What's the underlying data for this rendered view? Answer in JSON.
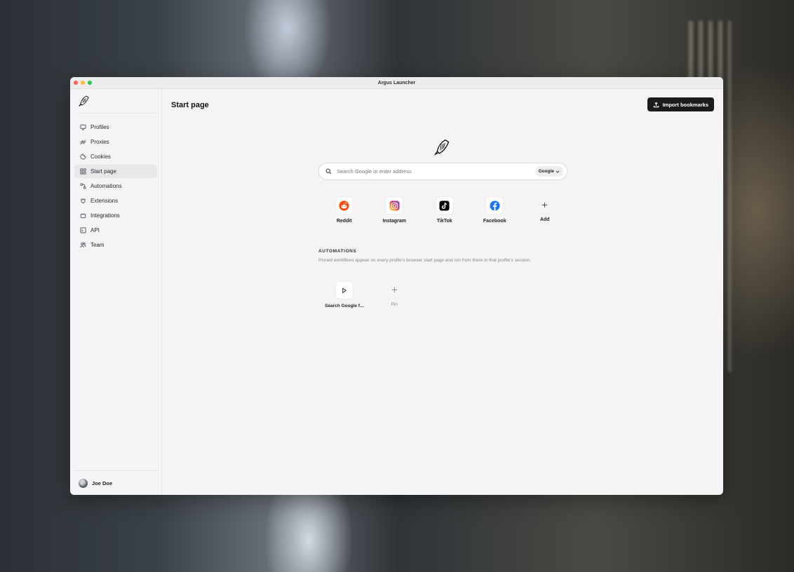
{
  "window": {
    "title": "Argus Launcher"
  },
  "sidebar": {
    "items": [
      {
        "label": "Profiles",
        "icon": "monitor-icon"
      },
      {
        "label": "Proxies",
        "icon": "proxy-icon"
      },
      {
        "label": "Cookies",
        "icon": "cookie-icon"
      },
      {
        "label": "Start page",
        "icon": "grid-icon",
        "active": true
      },
      {
        "label": "Automations",
        "icon": "automation-icon"
      },
      {
        "label": "Extensions",
        "icon": "plug-icon"
      },
      {
        "label": "Integrations",
        "icon": "integration-icon"
      },
      {
        "label": "API",
        "icon": "terminal-icon"
      },
      {
        "label": "Team",
        "icon": "team-icon"
      }
    ],
    "user": {
      "name": "Joe Doe"
    }
  },
  "header": {
    "title": "Start page",
    "import_label": "Import bookmarks"
  },
  "search": {
    "placeholder": "Search Google or enter address",
    "engine": "Google"
  },
  "shortcuts": [
    {
      "label": "Reddit",
      "icon": "reddit-icon",
      "color": "#ff4500"
    },
    {
      "label": "Instagram",
      "icon": "instagram-icon",
      "color": "#d62976"
    },
    {
      "label": "TikTok",
      "icon": "tiktok-icon",
      "color": "#000000"
    },
    {
      "label": "Facebook",
      "icon": "facebook-icon",
      "color": "#1877f2"
    },
    {
      "label": "Add",
      "icon": "plus-icon"
    }
  ],
  "automations": {
    "heading": "AUTOMATIONS",
    "description": "Pinned workflows appear on every profile's browser start page and run from there in that profile's session.",
    "items": [
      {
        "label": "Search Google f...",
        "icon": "play-icon"
      },
      {
        "label": "Pin",
        "icon": "plus-icon"
      }
    ]
  }
}
